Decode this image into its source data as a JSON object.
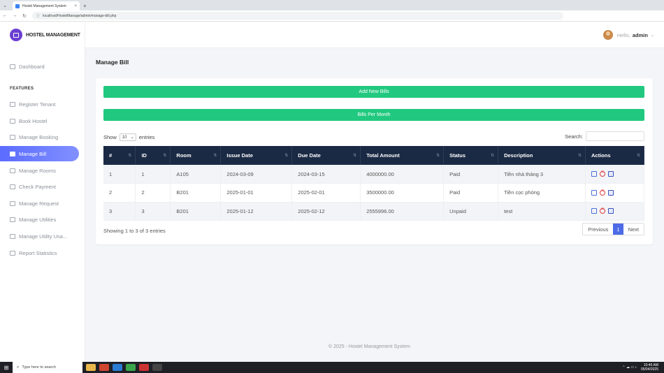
{
  "browser": {
    "tab_title": "Hostel Management System",
    "url": "localhost/HostelManage/admin/manage-bill.php"
  },
  "brand": {
    "name": "HOSTEL MANAGEMENT"
  },
  "sidebar": {
    "dashboard": "Dashboard",
    "section": "FEATURES",
    "items": [
      {
        "label": "Register Tenant"
      },
      {
        "label": "Book Hostel"
      },
      {
        "label": "Manage Booking"
      },
      {
        "label": "Manage Bill"
      },
      {
        "label": "Manage Rooms"
      },
      {
        "label": "Check Payment"
      },
      {
        "label": "Manage Request"
      },
      {
        "label": "Manage Utilities"
      },
      {
        "label": "Manage Utility Usa..."
      },
      {
        "label": "Report Statistics"
      }
    ]
  },
  "header": {
    "hello": "Hello,",
    "user": "admin"
  },
  "page": {
    "title": "Manage Bill"
  },
  "actions": {
    "add": "Add New Bills",
    "per_month": "Bills Per Month"
  },
  "controls": {
    "show": "Show",
    "entries_value": "10",
    "entries": "entries",
    "search_label": "Search:"
  },
  "table": {
    "headers": [
      "#",
      "ID",
      "Room",
      "Issue Date",
      "Due Date",
      "Total Amount",
      "Status",
      "Description",
      "Actions"
    ],
    "rows": [
      [
        "1",
        "1",
        "A105",
        "2024-03-09",
        "2024-03-15",
        "4000000.00",
        "Paid",
        "Tiền nhà tháng 3"
      ],
      [
        "2",
        "2",
        "B201",
        "2025-01-01",
        "2025-02-01",
        "3500000.00",
        "Paid",
        "Tiền cọc phòng"
      ],
      [
        "3",
        "3",
        "B201",
        "2025-01-12",
        "2025-02-12",
        "2555996.00",
        "Unpaid",
        "test"
      ]
    ]
  },
  "pagination": {
    "info": "Showing 1 to 3 of 3 entries",
    "prev": "Previous",
    "page": "1",
    "next": "Next"
  },
  "footer": {
    "text": "© 2025 - Hostel Management System"
  },
  "taskbar": {
    "search": "Type here to search",
    "time": "10:46 AM",
    "date": "05/04/2025"
  }
}
